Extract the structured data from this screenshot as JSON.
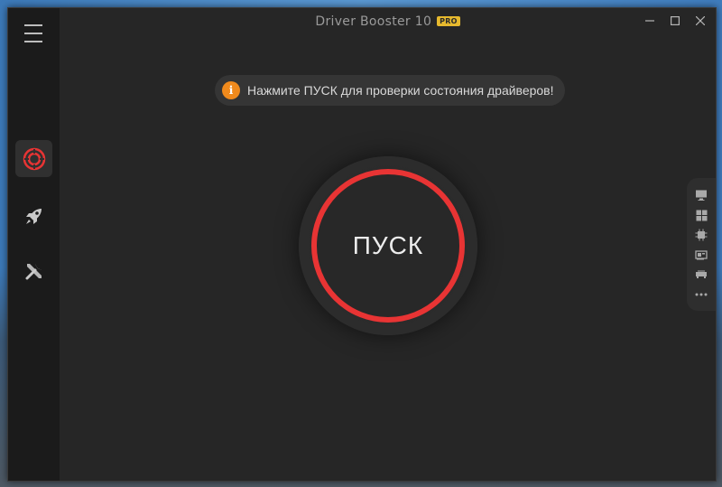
{
  "window": {
    "title": "Driver Booster 10",
    "badge": "PRO"
  },
  "notice": {
    "icon": "info-icon",
    "icon_glyph": "i",
    "text": "Нажмите ПУСК для проверки состояния драйверов!"
  },
  "scan": {
    "label": "ПУСК",
    "ring_color": "#e83434"
  },
  "sidebar": {
    "items": [
      {
        "name": "scan-tab",
        "icon": "target-icon",
        "active": true
      },
      {
        "name": "boost-tab",
        "icon": "rocket-icon",
        "active": false
      },
      {
        "name": "tools-tab",
        "icon": "tools-icon",
        "active": false
      }
    ]
  },
  "right_rail": {
    "items": [
      "monitor-icon",
      "windows-icon",
      "chip-icon",
      "network-card-icon",
      "device-icon",
      "more-icon"
    ]
  },
  "colors": {
    "accent": "#e83434",
    "info": "#f08a1c",
    "pro_badge": "#e6b92e",
    "background": "#262626",
    "sidebar": "#1b1b1b"
  }
}
